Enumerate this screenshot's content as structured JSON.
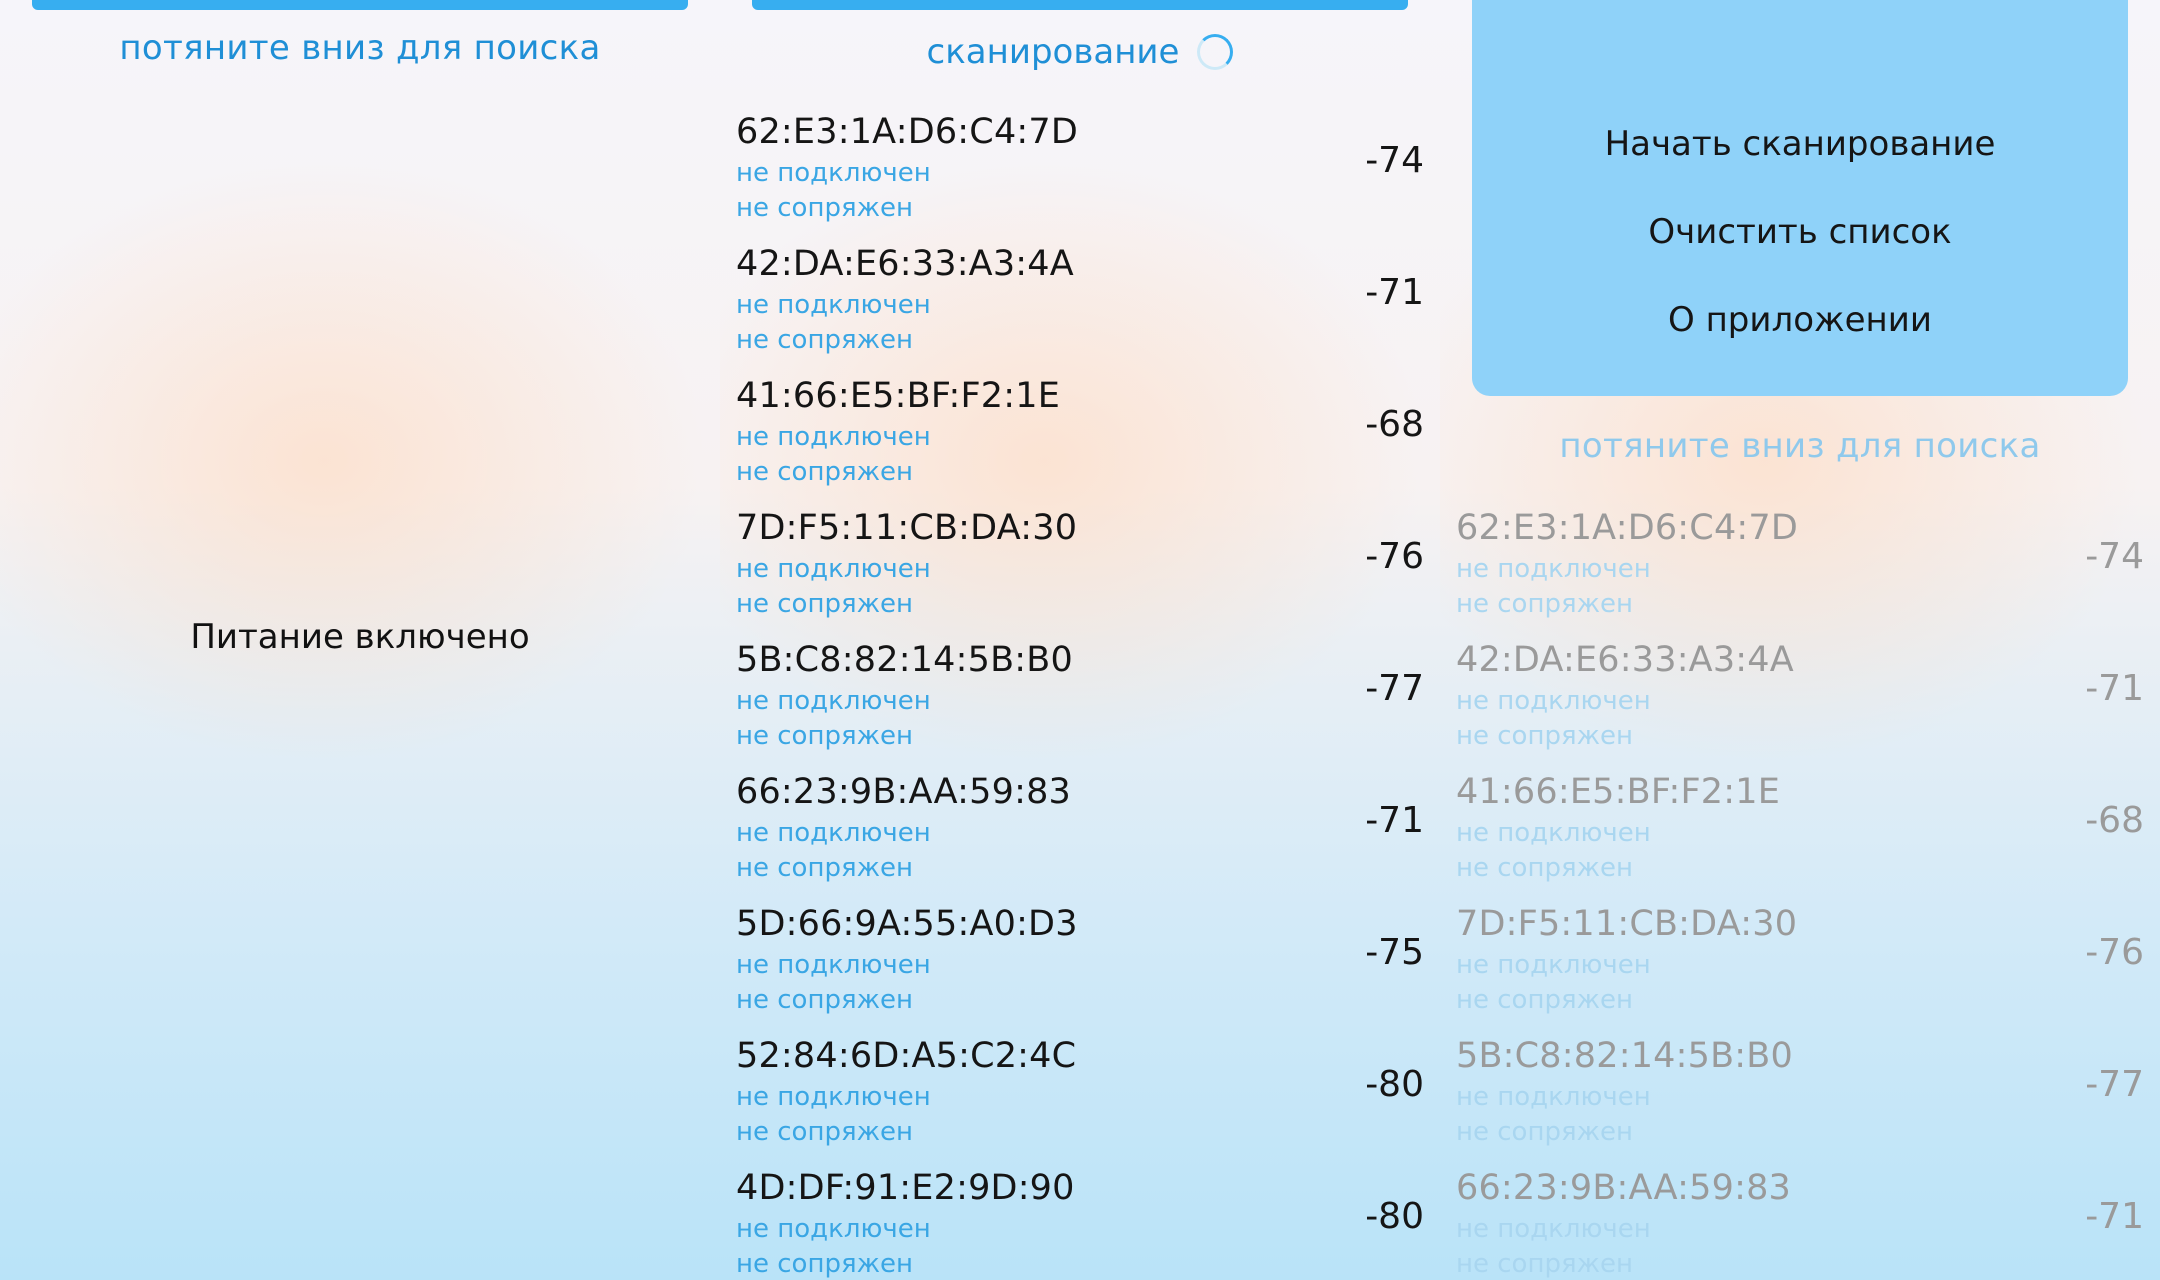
{
  "panel1": {
    "pull_hint": "потяните вниз для поиска",
    "power_status": "Питание включено"
  },
  "panel2": {
    "scan_label": "сканирование",
    "devices": [
      {
        "mac": "62:E3:1A:D6:C4:7D",
        "connection": "не подключен",
        "pairing": "не сопряжен",
        "rssi": "-74"
      },
      {
        "mac": "42:DA:E6:33:A3:4A",
        "connection": "не подключен",
        "pairing": "не сопряжен",
        "rssi": "-71"
      },
      {
        "mac": "41:66:E5:BF:F2:1E",
        "connection": "не подключен",
        "pairing": "не сопряжен",
        "rssi": "-68"
      },
      {
        "mac": "7D:F5:11:CB:DA:30",
        "connection": "не подключен",
        "pairing": "не сопряжен",
        "rssi": "-76"
      },
      {
        "mac": "5B:C8:82:14:5B:B0",
        "connection": "не подключен",
        "pairing": "не сопряжен",
        "rssi": "-77"
      },
      {
        "mac": "66:23:9B:AA:59:83",
        "connection": "не подключен",
        "pairing": "не сопряжен",
        "rssi": "-71"
      },
      {
        "mac": "5D:66:9A:55:A0:D3",
        "connection": "не подключен",
        "pairing": "не сопряжен",
        "rssi": "-75"
      },
      {
        "mac": "52:84:6D:A5:C2:4C",
        "connection": "не подключен",
        "pairing": "не сопряжен",
        "rssi": "-80"
      },
      {
        "mac": "4D:DF:91:E2:9D:90",
        "connection": "не подключен",
        "pairing": "не сопряжен",
        "rssi": "-80"
      }
    ]
  },
  "panel3": {
    "menu": [
      "Начать сканирование",
      "Очистить список",
      "О приложении"
    ],
    "pull_hint": "потяните вниз для поиска",
    "devices": [
      {
        "mac": "62:E3:1A:D6:C4:7D",
        "connection": "не подключен",
        "pairing": "не сопряжен",
        "rssi": "-74"
      },
      {
        "mac": "42:DA:E6:33:A3:4A",
        "connection": "не подключен",
        "pairing": "не сопряжен",
        "rssi": "-71"
      },
      {
        "mac": "41:66:E5:BF:F2:1E",
        "connection": "не подключен",
        "pairing": "не сопряжен",
        "rssi": "-68"
      },
      {
        "mac": "7D:F5:11:CB:DA:30",
        "connection": "не подключен",
        "pairing": "не сопряжен",
        "rssi": "-76"
      },
      {
        "mac": "5B:C8:82:14:5B:B0",
        "connection": "не подключен",
        "pairing": "не сопряжен",
        "rssi": "-77"
      },
      {
        "mac": "66:23:9B:AA:59:83",
        "connection": "не подключен",
        "pairing": "не сопряжен",
        "rssi": "-71"
      }
    ]
  },
  "colors": {
    "accent": "#37aef0",
    "status_text": "#3aa6e4",
    "menu_bg": "#8fd2f9"
  }
}
